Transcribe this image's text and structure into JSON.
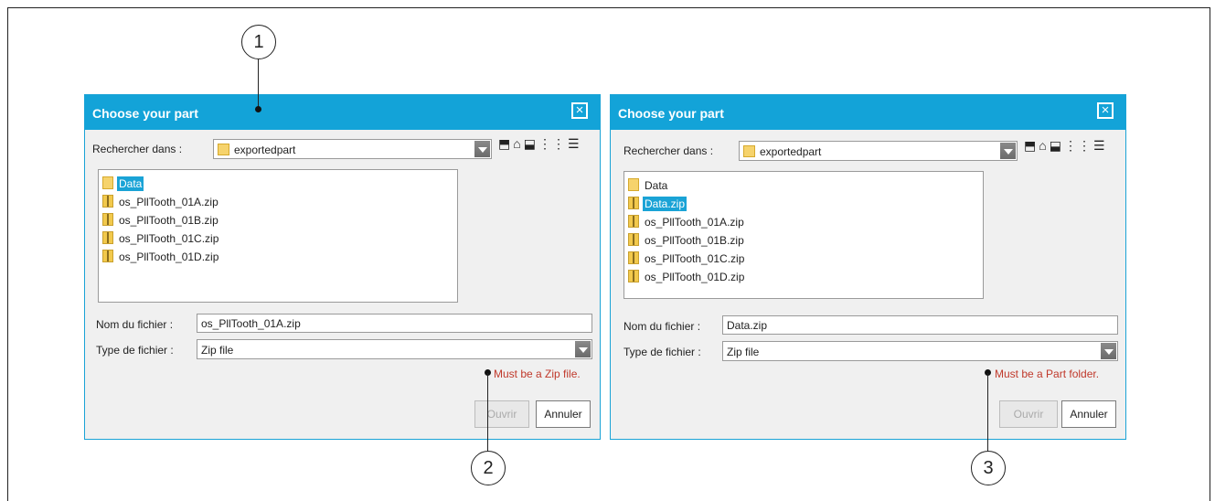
{
  "callouts": [
    "1",
    "2",
    "3"
  ],
  "dialogs": [
    {
      "title": "Choose your part",
      "search_label": "Rechercher dans :",
      "folder": "exportedpart",
      "files": [
        {
          "name": "Data",
          "type": "folder",
          "selected": true
        },
        {
          "name": "os_PllTooth_01A.zip",
          "type": "zip",
          "selected": false
        },
        {
          "name": "os_PllTooth_01B.zip",
          "type": "zip",
          "selected": false
        },
        {
          "name": "os_PllTooth_01C.zip",
          "type": "zip",
          "selected": false
        },
        {
          "name": "os_PllTooth_01D.zip",
          "type": "zip",
          "selected": false
        }
      ],
      "filename_label": "Nom du fichier :",
      "filename_value": "os_PllTooth_01A.zip",
      "filetype_label": "Type de fichier :",
      "filetype_value": "Zip file",
      "error": "Must be a Zip file.",
      "open_label": "Ouvrir",
      "cancel_label": "Annuler"
    },
    {
      "title": "Choose your part",
      "search_label": "Rechercher dans :",
      "folder": "exportedpart",
      "files": [
        {
          "name": "Data",
          "type": "folder",
          "selected": false
        },
        {
          "name": "Data.zip",
          "type": "zip",
          "selected": true
        },
        {
          "name": "os_PllTooth_01A.zip",
          "type": "zip",
          "selected": false
        },
        {
          "name": "os_PllTooth_01B.zip",
          "type": "zip",
          "selected": false
        },
        {
          "name": "os_PllTooth_01C.zip",
          "type": "zip",
          "selected": false
        },
        {
          "name": "os_PllTooth_01D.zip",
          "type": "zip",
          "selected": false
        }
      ],
      "filename_label": "Nom du fichier :",
      "filename_value": "Data.zip",
      "filetype_label": "Type de fichier :",
      "filetype_value": "Zip file",
      "error": "Must be a Part folder.",
      "open_label": "Ouvrir",
      "cancel_label": "Annuler"
    }
  ],
  "colors": {
    "titlebar": "#13a3d8",
    "selection": "#1aa3d6",
    "error": "#c0392b"
  }
}
